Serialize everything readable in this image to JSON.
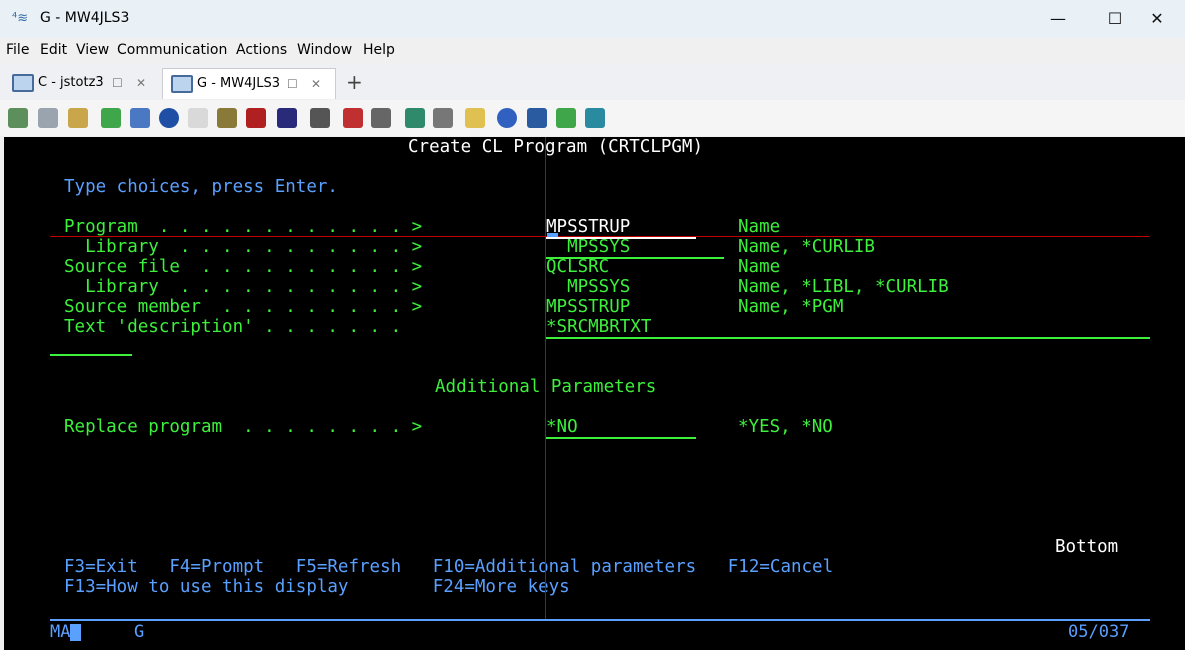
{
  "window": {
    "title": "G - MW4JLS3",
    "minimize": "—",
    "maximize": "☐",
    "close": "✕"
  },
  "menu": [
    "File",
    "Edit",
    "View",
    "Communication",
    "Actions",
    "Window",
    "Help"
  ],
  "tabs": [
    {
      "label": "C - jstotz3",
      "active": false
    },
    {
      "label": "G - MW4JLS3",
      "active": true
    }
  ],
  "tab_buttons": {
    "restore": "☐",
    "close": "✕",
    "new": "+"
  },
  "toolbar_icons": [
    "copy-icon",
    "paste-icon",
    "clipboard-icon",
    "download-icon",
    "file-icon",
    "navigator-icon",
    "notes-icon",
    "archive-icon",
    "sql-icon",
    "grid-icon",
    "tools-icon",
    "connect-icon",
    "disconnect-icon",
    "transfer-icon",
    "print-icon",
    "macro-icon",
    "help-icon",
    "globe-icon",
    "upload-icon",
    "screen-icon"
  ],
  "screen": {
    "title": "Create CL Program (CRTCLPGM)",
    "instructions": "Type choices, press Enter.",
    "fields": [
      {
        "label": "Program  . . . . . . . . . . . . >",
        "value": "MPSSTRUP",
        "hint": "Name"
      },
      {
        "label": "  Library  . . . . . . . . . . . >",
        "value": "  MPSSYS",
        "hint": "Name, *CURLIB"
      },
      {
        "label": "Source file  . . . . . . . . . . >",
        "value": "QCLSRC",
        "hint": "Name"
      },
      {
        "label": "  Library  . . . . . . . . . . . >",
        "value": "  MPSSYS",
        "hint": "Name, *LIBL, *CURLIB"
      },
      {
        "label": "Source member  . . . . . . . . . >",
        "value": "MPSSTRUP",
        "hint": "Name, *PGM"
      },
      {
        "label": "Text 'description' . . . . . . .  ",
        "value": "*SRCMBRTXT",
        "hint": ""
      }
    ],
    "additional_header": "Additional Parameters",
    "replace": {
      "label": "Replace program  . . . . . . . . >",
      "value": "*NO",
      "hint": "*YES, *NO"
    },
    "bottom": "Bottom",
    "fkeys_line1": "F3=Exit   F4=Prompt   F5=Refresh   F10=Additional parameters   F12=Cancel",
    "fkeys_line2": "F13=How to use this display        F24=More keys"
  },
  "status": {
    "mode": "MA",
    "session": "G",
    "position": "05/037"
  }
}
